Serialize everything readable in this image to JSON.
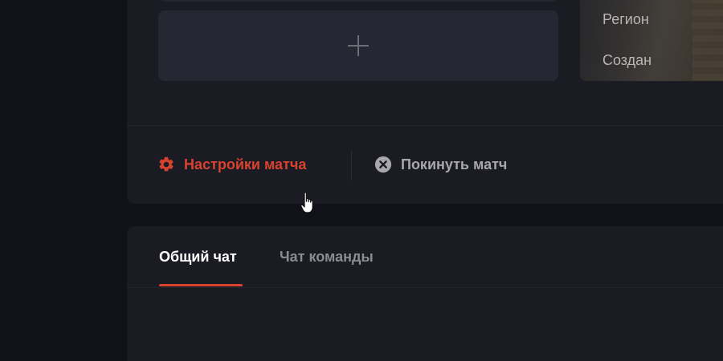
{
  "map_info": {
    "region_label": "Регион",
    "created_label": "Создан"
  },
  "actions": {
    "settings_label": "Настройки матча",
    "leave_label": "Покинуть матч"
  },
  "chat": {
    "tabs": [
      {
        "label": "Общий чат",
        "active": true
      },
      {
        "label": "Чат команды",
        "active": false
      }
    ]
  },
  "colors": {
    "accent": "#d8432f",
    "background": "#111119",
    "card": "#1b1b23"
  },
  "icons": {
    "settings": "gear-icon",
    "leave": "close-circle-icon",
    "add": "plus-icon",
    "cursor": "hand-pointer-icon"
  }
}
